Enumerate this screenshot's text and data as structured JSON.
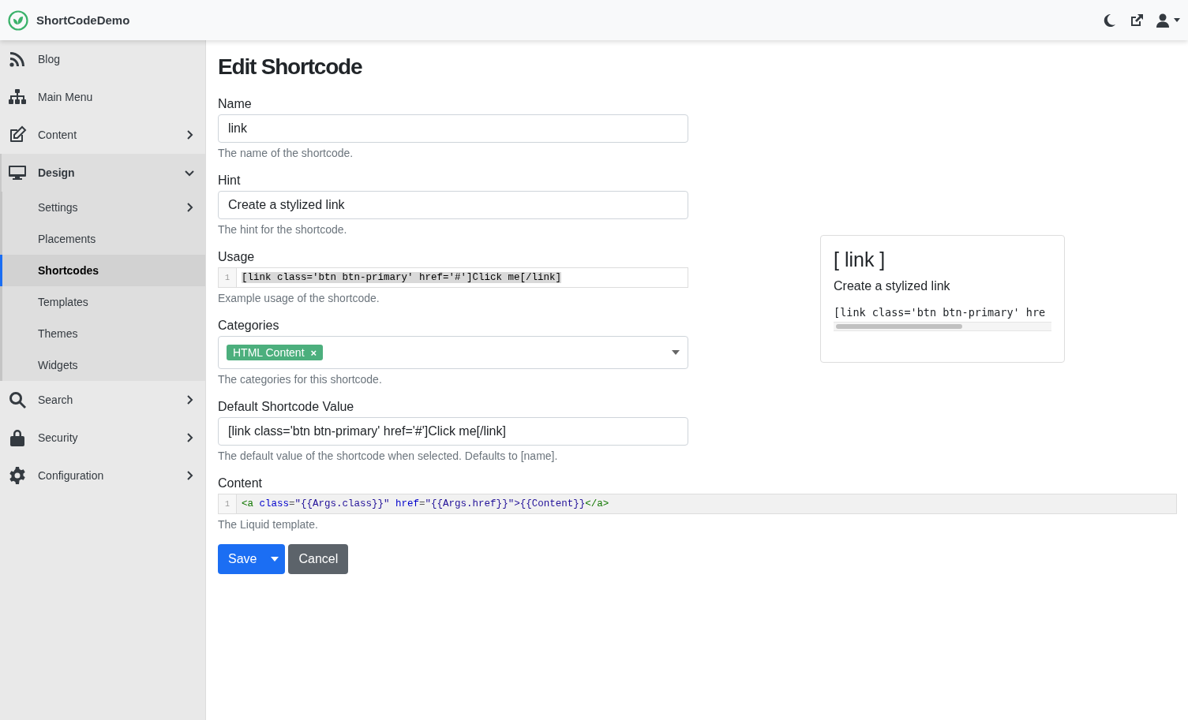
{
  "app": {
    "title": "ShortCodeDemo"
  },
  "sidebar": {
    "items": [
      {
        "label": "Blog",
        "kind": "link",
        "selected": false
      },
      {
        "label": "Main Menu",
        "kind": "link",
        "selected": false
      },
      {
        "label": "Content",
        "kind": "group",
        "expanded": false,
        "selected": false
      },
      {
        "label": "Design",
        "kind": "group",
        "expanded": true,
        "selected": false,
        "children": [
          {
            "label": "Settings",
            "kind": "group",
            "expanded": false,
            "selected": false
          },
          {
            "label": "Placements",
            "kind": "link",
            "selected": false
          },
          {
            "label": "Shortcodes",
            "kind": "link",
            "selected": true
          },
          {
            "label": "Templates",
            "kind": "link",
            "selected": false
          },
          {
            "label": "Themes",
            "kind": "link",
            "selected": false
          },
          {
            "label": "Widgets",
            "kind": "link",
            "selected": false
          }
        ]
      },
      {
        "label": "Search",
        "kind": "group",
        "expanded": false,
        "selected": false
      },
      {
        "label": "Security",
        "kind": "group",
        "expanded": false,
        "selected": false
      },
      {
        "label": "Configuration",
        "kind": "group",
        "expanded": false,
        "selected": false
      }
    ]
  },
  "page": {
    "title": "Edit Shortcode"
  },
  "fields": [
    {
      "kind": "text",
      "label": "Name",
      "value": "link",
      "hint": "The name of the shortcode."
    },
    {
      "kind": "text",
      "label": "Hint",
      "value": "Create a stylized link",
      "hint": "The hint for the shortcode."
    },
    {
      "kind": "code",
      "label": "Usage",
      "line_number": "1",
      "tokens": [
        {
          "kind": "plain",
          "text": "[link class='btn btn-primary' href='#']Click me[/link]"
        }
      ],
      "selected": true,
      "hint": "Example usage of the shortcode."
    },
    {
      "kind": "tags",
      "label": "Categories",
      "tags": [
        "HTML Content"
      ],
      "remove": "×",
      "hint": "The categories for this shortcode."
    },
    {
      "kind": "text",
      "label": "Default Shortcode Value",
      "value": "[link class='btn btn-primary' href='#']Click me[/link]",
      "hint": "The default value of the shortcode when selected. Defaults to [name]."
    }
  ],
  "content_field": {
    "label": "Content",
    "line_number": "1",
    "tokens": [
      {
        "kind": "tag",
        "text": "<a "
      },
      {
        "kind": "attr",
        "text": "class"
      },
      {
        "kind": "punct",
        "text": "="
      },
      {
        "kind": "string",
        "text": "\"{{Args.class}}\" "
      },
      {
        "kind": "attr",
        "text": "href"
      },
      {
        "kind": "punct",
        "text": "="
      },
      {
        "kind": "string",
        "text": "\"{{Args.href}}\">{{Content}}"
      },
      {
        "kind": "tag",
        "text": "</a>"
      }
    ],
    "selected": false,
    "hint": "The Liquid template."
  },
  "buttons": [
    {
      "label": "Save",
      "kind": "primary"
    },
    {
      "label": "Cancel",
      "kind": "secondary"
    }
  ],
  "preview": {
    "title": "[ link ]",
    "hint": "Create a stylized link",
    "usage": "[link class='btn btn-primary' hre"
  }
}
